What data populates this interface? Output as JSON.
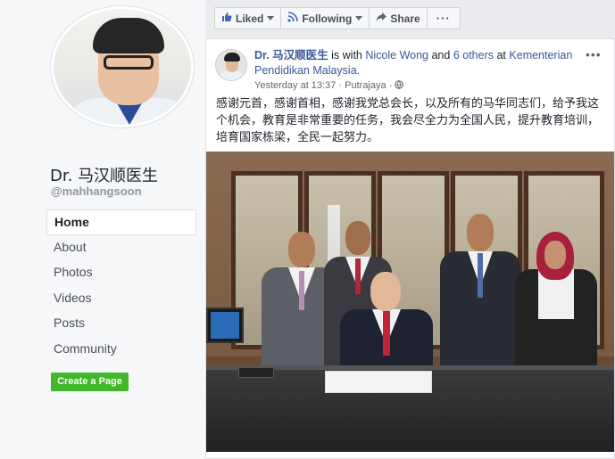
{
  "profile": {
    "name": "Dr. 马汉顺医生",
    "handle": "@mahhangsoon"
  },
  "nav": {
    "items": [
      {
        "label": "Home",
        "active": true
      },
      {
        "label": "About"
      },
      {
        "label": "Photos"
      },
      {
        "label": "Videos"
      },
      {
        "label": "Posts"
      },
      {
        "label": "Community"
      }
    ],
    "create_page": "Create a Page"
  },
  "actions": {
    "liked": "Liked",
    "following": "Following",
    "share": "Share",
    "more": "···"
  },
  "post": {
    "author": "Dr. 马汉顺医生",
    "is_with": "is with",
    "with_people": "Nicole Wong",
    "and_text": "and",
    "others": "6 others",
    "at_text": "at",
    "location": "Kementerian Pendidikan Malaysia.",
    "time": "Yesterday at 13:37",
    "separator": "·",
    "place": "Putrajaya",
    "privacy_dot": "·",
    "menu": "•••",
    "text": "感谢元首，感谢首相，感谢我党总会长，以及所有的马华同志们，给予我这个机会，教育是非常重要的任务，我会尽全力为全国人民，提升教育培训，培育国家栋梁，全民一起努力。"
  },
  "colors": {
    "link": "#365899",
    "green": "#42b72a",
    "bg": "#e9ebee"
  }
}
